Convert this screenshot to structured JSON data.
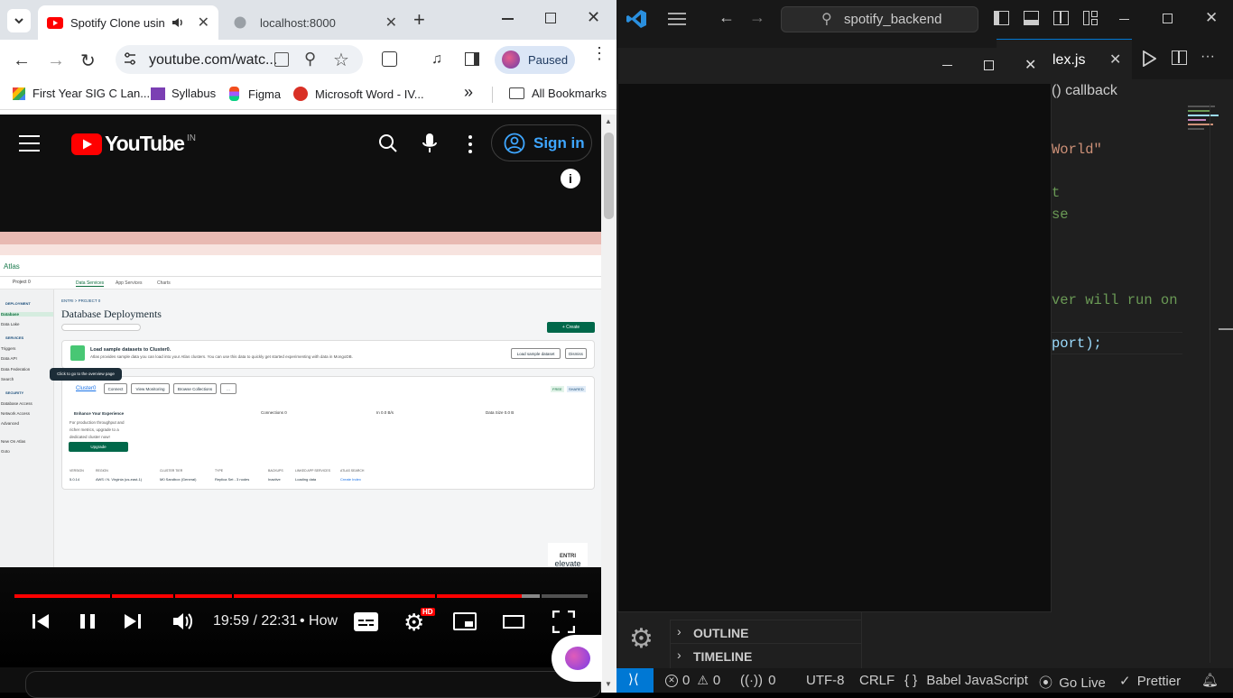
{
  "browser": {
    "tabs": [
      {
        "title": "Spotify Clone using",
        "active": true
      },
      {
        "title": "localhost:8000",
        "active": false
      }
    ],
    "new_tab": "+",
    "url": "youtube.com/watc...",
    "profile_status": "Paused",
    "bookmarks": [
      "First Year SIG C Lan...",
      "Syllabus",
      "Figma",
      "Microsoft Word - IV...",
      "All Bookmarks"
    ],
    "more_bookmarks": "»"
  },
  "youtube": {
    "logo": "YouTube",
    "country": "IN",
    "sign_in": "Sign in",
    "time": "19:59 / 22:31",
    "chapter": "• How",
    "quality_badge": "HD",
    "progress": 0.94,
    "video": {
      "page_title": "Database Deployments",
      "breadcrumb": "ENTRI > PROJECT 0",
      "banner_title": "Load sample datasets to Cluster0.",
      "banner_text": "Atlas provides sample data you can load into your Atlas clusters. You can use this data to quickly get started experimenting with data in MongoDB.",
      "cluster_name": "Cluster0",
      "tooltip": "Click to go to the overview page",
      "buttons": [
        "Connect",
        "View Monitoring",
        "Browse Collections",
        "..."
      ],
      "create": "+ Create",
      "load_btn": "Load sample dataset",
      "dismiss": "Dismiss",
      "watermark_top": "ENTRI",
      "watermark_bottom": "elevate",
      "sidebar": [
        "DEPLOYMENT",
        "Database",
        "Data Lake",
        "SERVICES",
        "Triggers",
        "Data API",
        "Data Federation",
        "Search",
        "SECURITY",
        "Database Access",
        "Network Access",
        "Advanced",
        "New On Atlas",
        "Goto"
      ],
      "nav_tabs": [
        "Data Services",
        "App Services",
        "Charts"
      ],
      "upgrade": "Upgrade",
      "enhance": "Enhance Your Experience",
      "enhance_text": "For production throughput and richer metrics, upgrade to a dedicated cluster now!",
      "metrics": [
        "Connections 0",
        "In 0.0 B/s",
        "Data Size 0.0 B"
      ],
      "table_headers": [
        "VERSION",
        "REGION",
        "CLUSTER TIER",
        "TYPE",
        "BACKUPS",
        "LINKED APP SERVICES",
        "ATLAS SEARCH"
      ],
      "table_values": [
        "5.0.14",
        "AWS / N. Virginia (us-east-1)",
        "M0 Sandbox (General)",
        "Replica Set - 3 nodes",
        "Inactive",
        "Loading data",
        "Create Index"
      ],
      "badges": [
        "FREE",
        "SHARED"
      ],
      "project": "Project 0"
    }
  },
  "vscode": {
    "search": "spotify_backend",
    "tab_label": "lex.js",
    "breadcrumb": "() callback",
    "code_lines": [
      {
        "text": "World\"",
        "color": "#ce9178"
      },
      {
        "text": "t",
        "color": "#6a9955"
      },
      {
        "text": "se",
        "color": "#6a9955"
      },
      {
        "text": "ver will run on",
        "color": "#6a9955"
      },
      {
        "text": "port);",
        "color": "#9cdcfe"
      }
    ],
    "outline": "OUTLINE",
    "timeline": "TIMELINE",
    "status": {
      "errors": "0",
      "warnings": "0",
      "ports": "0",
      "encoding": "UTF-8",
      "eol": "CRLF",
      "language": "Babel JavaScript",
      "live": "Go Live",
      "prettier": "Prettier",
      "braces": "{ }"
    }
  }
}
